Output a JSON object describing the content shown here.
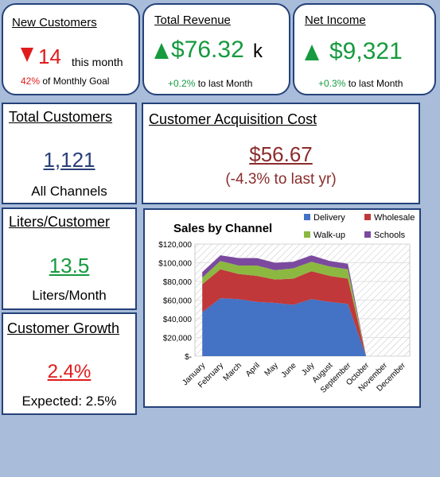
{
  "new_customers": {
    "title": "New Customers",
    "value": "14",
    "period": "this month",
    "goal_pct": "42%",
    "goal_text": "of Monthly Goal",
    "trend": "down"
  },
  "total_revenue": {
    "title": "Total Revenue",
    "value": "$76.32",
    "unit": "k",
    "change_pct": "+0.2%",
    "change_text": "to last Month",
    "trend": "up"
  },
  "net_income": {
    "title": "Net Income",
    "value": "$9,321",
    "change_pct": "+0.3%",
    "change_text": "to last Month",
    "trend": "up"
  },
  "total_customers": {
    "title": "Total Customers",
    "value": "1,121",
    "subtitle": "All Channels"
  },
  "acquisition_cost": {
    "title": "Customer Acquisition Cost",
    "value": "$56.67",
    "change": "(-4.3% to last yr)"
  },
  "liters_customer": {
    "title": "Liters/Customer",
    "value": "13.5",
    "subtitle": "Liters/Month"
  },
  "customer_growth": {
    "title": "Customer Growth",
    "value": "2.4%",
    "expected": "Expected: 2.5%"
  },
  "colors": {
    "background": "#a9bcd9",
    "border": "#24427a",
    "green": "#169a3f",
    "red": "#e01b1b",
    "navy": "#2a3f7a",
    "maroon": "#8b2c2c",
    "delivery": "#4472c4",
    "wholesale": "#c0383a",
    "walkup": "#8cb841",
    "schools": "#7b4a9e"
  },
  "chart_data": {
    "type": "area",
    "stacked": true,
    "title": "Sales by Channel",
    "categories": [
      "January",
      "February",
      "March",
      "April",
      "May",
      "June",
      "July",
      "August",
      "September",
      "October",
      "November",
      "December"
    ],
    "series": [
      {
        "name": "Delivery",
        "color": "#4472c4",
        "values": [
          47000,
          62000,
          61000,
          58000,
          57000,
          55000,
          61000,
          58000,
          56000,
          0
        ]
      },
      {
        "name": "Wholesale",
        "color": "#c0383a",
        "values": [
          30000,
          31000,
          27000,
          28000,
          25000,
          28000,
          30000,
          28000,
          27000,
          0
        ]
      },
      {
        "name": "Walk-up",
        "color": "#8cb841",
        "values": [
          7000,
          9000,
          9000,
          11000,
          10000,
          11000,
          10000,
          10000,
          10000,
          0
        ]
      },
      {
        "name": "Schools",
        "color": "#7b4a9e",
        "values": [
          6000,
          6000,
          8000,
          8000,
          8000,
          7000,
          7000,
          6000,
          6000,
          0
        ]
      }
    ],
    "y_ticks": [
      "$120,000",
      "$100,000",
      "$80,000",
      "$60,000",
      "$40,000",
      "$20,000",
      "$-"
    ],
    "ylim": [
      0,
      120000
    ],
    "legend_position": "top-right",
    "grid": true
  }
}
